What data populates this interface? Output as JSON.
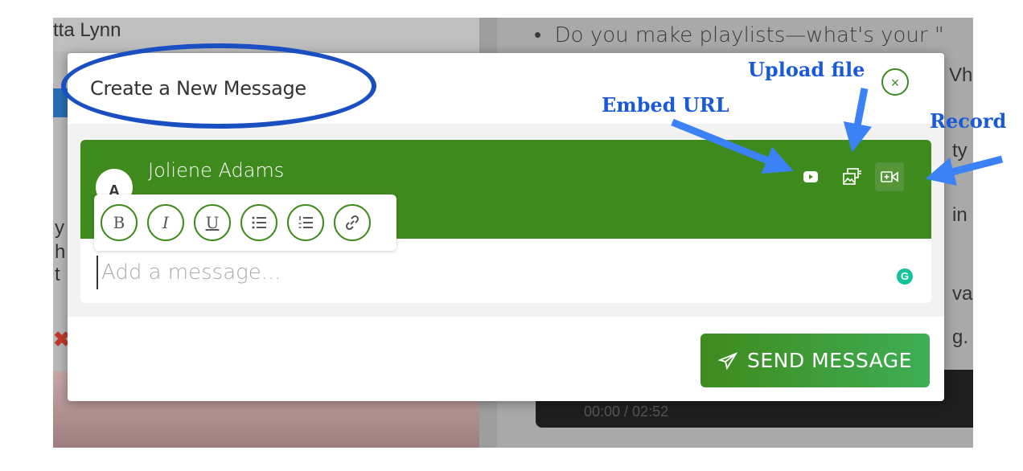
{
  "background": {
    "left_name_fragment": "tta Lynn",
    "right_bullet_text": "Do you make playlists—what's your \"",
    "right_fragments": [
      "Vh",
      "ty",
      "in",
      "va",
      "g."
    ],
    "left_fragments": [
      "y",
      "h",
      "t"
    ],
    "player_time": "00:00 / 02:52"
  },
  "modal": {
    "title": "Create a New Message",
    "close_symbol": "×",
    "composer": {
      "avatar_initial": "A",
      "author_name": "Joliene Adams",
      "format_buttons": [
        "B",
        "I",
        "U",
        "bulleted-list",
        "numbered-list",
        "link"
      ],
      "message_placeholder": "Add a message...",
      "grammarly_letter": "G"
    },
    "send_button": {
      "icon": "paper-plane-icon",
      "label": "SEND MESSAGE"
    }
  },
  "annotations": {
    "embed_url": "Embed URL",
    "upload_file": "Upload file",
    "record": "Record"
  },
  "colors": {
    "accent_green": "#3f8a1d",
    "annotation_blue": "#1a5ad6",
    "arrow_blue": "#3b82f6"
  }
}
